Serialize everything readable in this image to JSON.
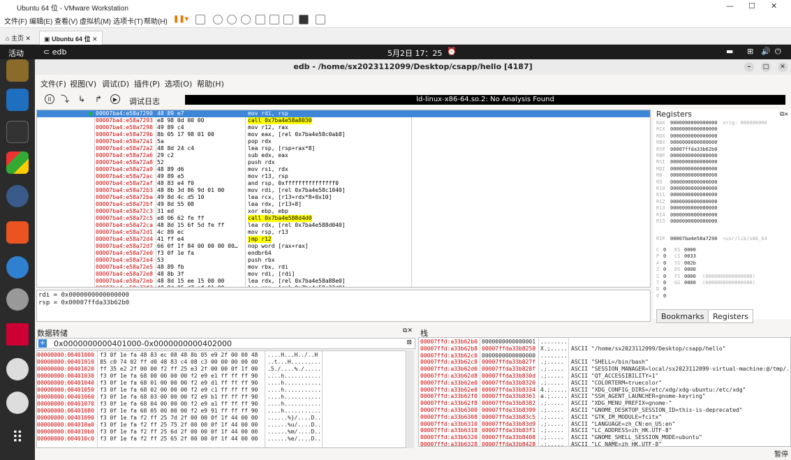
{
  "vmware": {
    "title": "Ubuntu 64 位 - VMware Workstation",
    "menu": [
      "文件(F)",
      "编辑(E)",
      "查看(V)",
      "虚拟机(M)",
      "选项卡(T)",
      "帮助(H)"
    ],
    "tabs": [
      "主页",
      "Ubuntu 64 位"
    ]
  },
  "gnome": {
    "activities": "活动",
    "app": "edb",
    "clock": "5月2日 17：25"
  },
  "edb": {
    "title": "edb - /home/sx2023112099/Desktop/csapp/hello [4187]",
    "menu": [
      "文件(F)",
      "视图(V)",
      "调试(D)",
      "插件(P)",
      "选项(O)",
      "帮助(H)"
    ],
    "log_button": "调试日志",
    "status": "ld-linux-x86-64.so.2: No Analysis Found",
    "disasm": [
      {
        "addr": "00007ba4:e58a7290",
        "bytes": "48 89 e7",
        "ins": "mov rdi, rsp",
        "sel": true
      },
      {
        "addr": "00007ba4:e58a7293",
        "bytes": "e8 98 0d 00 00",
        "ins": "call 0x7ba4e58a8030",
        "hl": "call"
      },
      {
        "addr": "00007ba4:e58a7298",
        "bytes": "49 89 c4",
        "ins": "mov r12, rax"
      },
      {
        "addr": "00007ba4:e58a729b",
        "bytes": "8b 05 17 98 01 00",
        "ins": "mov eax, [rel 0x7ba4e58c0ab8]"
      },
      {
        "addr": "00007ba4:e58a72a1",
        "bytes": "5a",
        "ins": "pop rdx"
      },
      {
        "addr": "00007ba4:e58a72a2",
        "bytes": "48 8d 24 c4",
        "ins": "lea rsp, [rsp+rax*8]"
      },
      {
        "addr": "00007ba4:e58a72a6",
        "bytes": "29 c2",
        "ins": "sub edx, eax"
      },
      {
        "addr": "00007ba4:e58a72a8",
        "bytes": "52",
        "ins": "push rdx"
      },
      {
        "addr": "00007ba4:e58a72a9",
        "bytes": "48 89 d6",
        "ins": "mov rsi, rdx"
      },
      {
        "addr": "00007ba4:e58a72ac",
        "bytes": "49 89 e5",
        "ins": "mov r13, rsp"
      },
      {
        "addr": "00007ba4:e58a72af",
        "bytes": "48 83 e4 f0",
        "ins": "and rsp, 0xfffffffffffffff0"
      },
      {
        "addr": "00007ba4:e58a72b3",
        "bytes": "48 8b 3d 86 9d 01 00",
        "ins": "mov rdi, [rel 0x7ba4e58c1040]"
      },
      {
        "addr": "00007ba4:e58a72ba",
        "bytes": "49 8d 4c d5 10",
        "ins": "lea rcx, [r13+rdx*8+0x10]"
      },
      {
        "addr": "00007ba4:e58a72bf",
        "bytes": "49 8d 55 08",
        "ins": "lea rdx, [r13+8]"
      },
      {
        "addr": "00007ba4:e58a72c3",
        "bytes": "31 ed",
        "ins": "xor ebp, ebp"
      },
      {
        "addr": "00007ba4:e58a72c5",
        "bytes": "e8 06 62 fe ff",
        "ins": "call 0x7ba4e588d4d0",
        "hl": "call"
      },
      {
        "addr": "00007ba4:e58a72ca",
        "bytes": "48 8d 15 6f 5d fe ff",
        "ins": "lea rdx, [rel 0x7ba4e588d040]"
      },
      {
        "addr": "00007ba4:e58a72d1",
        "bytes": "4c 89 ec",
        "ins": "mov rsp, r13"
      },
      {
        "addr": "00007ba4:e58a72d4",
        "bytes": "41 ff e4",
        "ins": "jmp r12",
        "hl": "jmp"
      },
      {
        "addr": "00007ba4:e58a72d7",
        "bytes": "66 0f 1f 84 00 00 00 00…",
        "ins": "nop word [rax+rax]",
        "dim": true
      },
      {
        "addr": "00007ba4:e58a72e0",
        "bytes": "f3 0f 1e fa",
        "ins": "endbr64"
      },
      {
        "addr": "00007ba4:e58a72e4",
        "bytes": "53",
        "ins": "push rbx"
      },
      {
        "addr": "00007ba4:e58a72e5",
        "bytes": "48 89 fb",
        "ins": "mov rbx, rdi"
      },
      {
        "addr": "00007ba4:e58a72e8",
        "bytes": "48 8b 3f",
        "ins": "mov rdi, [rdi]"
      },
      {
        "addr": "00007ba4:e58a72eb",
        "bytes": "48 8d 15 ee 15 00 00",
        "ins": "lea rdx, [rel 0x7ba4e58a88e0]"
      },
      {
        "addr": "00007ba4:e58a72f2",
        "bytes": "48 8d 05 d7 af 01 00",
        "ins": "lea rax, [rel 0x7ba4e58c22d0]"
      }
    ],
    "expr": [
      "rdi = 0x0000000000000000",
      "rsp = 0x00007ffda33b62b0"
    ],
    "registers": {
      "header": "Registers",
      "gp": [
        [
          "RAX",
          "0000000000000000",
          "orig: 000000000"
        ],
        [
          "RCX",
          "0000000000000000",
          ""
        ],
        [
          "RDX",
          "0000000000000000",
          ""
        ],
        [
          "RBX",
          "0000000000000000",
          ""
        ],
        [
          "RSP",
          "00007ffda33b62b0",
          ""
        ],
        [
          "RBP",
          "0000000000000000",
          ""
        ],
        [
          "RSI",
          "0000000000000000",
          ""
        ],
        [
          "RDI",
          "0000000000000000",
          ""
        ],
        [
          "R8",
          "0000000000000000",
          ""
        ],
        [
          "R9",
          "0000000000000000",
          ""
        ],
        [
          "R10",
          "0000000000000000",
          ""
        ],
        [
          "R11",
          "0000000000000000",
          ""
        ],
        [
          "R12",
          "0000000000000000",
          ""
        ],
        [
          "R13",
          "0000000000000000",
          ""
        ],
        [
          "R14",
          "0000000000000000",
          ""
        ],
        [
          "R15",
          "0000000000000000",
          ""
        ]
      ],
      "rip": [
        "RIP",
        "00007ba4e58a7290",
        "<usr/lib/x86_64"
      ],
      "flags": [
        [
          "C",
          "0",
          "ES",
          "0000",
          ""
        ],
        [
          "P",
          "0",
          "CS",
          "0033",
          ""
        ],
        [
          "A",
          "0",
          "SS",
          "002b",
          ""
        ],
        [
          "Z",
          "0",
          "DS",
          "0000",
          ""
        ],
        [
          "S",
          "0",
          "FS",
          "0000",
          "(0000000000000000)"
        ],
        [
          "T",
          "0",
          "GS",
          "0000",
          "(0000000000000000)"
        ],
        [
          "D",
          "0",
          "",
          "",
          ""
        ],
        [
          "O",
          "0",
          "",
          "",
          ""
        ]
      ]
    },
    "reg_tabs": [
      "Bookmarks",
      "Registers"
    ],
    "dump": {
      "header": "数据转储",
      "range": "0x0000000000401000-0x0000000000402000",
      "rows": [
        [
          "00000000:00401000",
          "f3 0f 1e fa 48 83 ec 08 48 8b 05 e9 2f 00 00 48",
          "....H...H../..H"
        ],
        [
          "00000000:00401010",
          "85 c0 74 02 ff d0 48 83 c4 08 c3 00 00 00 00 00",
          "..t...H........."
        ],
        [
          "00000000:00401020",
          "ff 35 e2 2f 00 00 f2 ff 25 e3 2f 00 00 0f 1f 00",
          ".5./....%./....."
        ],
        [
          "00000000:00401030",
          "f3 0f 1e fa 68 00 00 00 00 f2 e9 e1 ff ff ff 90",
          "....h..........."
        ],
        [
          "00000000:00401040",
          "f3 0f 1e fa 68 01 00 00 00 f2 e9 d1 ff ff ff 90",
          "....h..........."
        ],
        [
          "00000000:00401050",
          "f3 0f 1e fa 68 02 00 00 00 f2 e9 c1 ff ff ff 90",
          "....h..........."
        ],
        [
          "00000000:00401060",
          "f3 0f 1e fa 68 03 00 00 00 f2 e9 b1 ff ff ff 90",
          "....h..........."
        ],
        [
          "00000000:00401070",
          "f3 0f 1e fa 68 04 00 00 00 f2 e9 a1 ff ff ff 90",
          "....h..........."
        ],
        [
          "00000000:00401080",
          "f3 0f 1e fa 68 05 00 00 00 f2 e9 91 ff ff ff 90",
          "....h..........."
        ],
        [
          "00000000:00401090",
          "f3 0f 1e fa f2 ff 25 7d 2f 00 00 0f 1f 44 00 00",
          "......%}/....D.."
        ],
        [
          "00000000:004010a0",
          "f3 0f 1e fa f2 ff 25 75 2f 00 00 0f 1f 44 00 00",
          "......%u/....D.."
        ],
        [
          "00000000:004010b0",
          "f3 0f 1e fa f2 ff 25 6d 2f 00 00 0f 1f 44 00 00",
          "......%m/....D.."
        ],
        [
          "00000000:004010c0",
          "f3 0f 1e fa f2 ff 25 65 2f 00 00 0f 1f 44 00 00",
          "......%e/....D.."
        ]
      ]
    },
    "stack": {
      "header": "栈",
      "rows": [
        [
          "00007ffd:a33b62b0",
          "0000000000000001",
          "........",
          ""
        ],
        [
          "00007ffd:a33b62b8",
          "00007ffda33b8258",
          "X.;.....",
          "ASCII \"/home/sx2023112099/Desktop/csapp/hello\""
        ],
        [
          "00007ffd:a33b62c0",
          "0000000000000000",
          "........",
          ""
        ],
        [
          "00007ffd:a33b62c8",
          "00007ffda33b827f",
          ".;.....",
          "ASCII \"SHELL=/bin/bash\""
        ],
        [
          "00007ffd:a33b62d0",
          "00007ffda33b828f",
          ".;.....",
          "ASCII \"SESSION_MANAGER=local/sx2023112099-virtual-machine:@/tmp/.\""
        ],
        [
          "00007ffd:a33b62d8",
          "00007ffda33b830d",
          ".;.....",
          "ASCII \"QT_ACCESSIBILITY=1\""
        ],
        [
          "00007ffd:a33b62e0",
          "00007ffda33b8320",
          ".;.....",
          "ASCII \"COLORTERM=truecolor\""
        ],
        [
          "00007ffd:a33b62e8",
          "00007ffda33b8334",
          "4.;.....",
          "ASCII \"XDG_CONFIG_DIRS=/etc/xdg/xdg-ubuntu:/etc/xdg\""
        ],
        [
          "00007ffd:a33b62f0",
          "00007ffda33b8361",
          "a.;.....",
          "ASCII \"SSH_AGENT_LAUNCHER=gnome-keyring\""
        ],
        [
          "00007ffd:a33b62f8",
          "00007ffda33b8382",
          ".;.....",
          "ASCII \"XDG_MENU_PREFIX=gnome-\""
        ],
        [
          "00007ffd:a33b6300",
          "00007ffda33b8399",
          ".;.....",
          "ASCII \"GNOME_DESKTOP_SESSION_ID=this-is-deprecated\""
        ],
        [
          "00007ffd:a33b6308",
          "00007ffda33b83c5",
          ".;.....",
          "ASCII \"GTK_IM_MODULE=fcitx\""
        ],
        [
          "00007ffd:a33b6310",
          "00007ffda33b83d9",
          ".;.....",
          "ASCII \"LANGUAGE=zh_CN:en_US:en\""
        ],
        [
          "00007ffd:a33b6318",
          "00007ffda33b83f1",
          ".;.....",
          "ASCII \"LC_ADDRESS=zh_HK.UTF-8\""
        ],
        [
          "00007ffd:a33b6320",
          "00007ffda33b8408",
          ".;.....",
          "ASCII \"GNOME_SHELL_SESSION_MODE=ubuntu\""
        ],
        [
          "00007ffd:a33b6328",
          "00007ffda33b8428",
          ".;.....",
          "ASCII \"LC_NAME=zh_HK.UTF-8\""
        ]
      ]
    },
    "pause": "暂停"
  }
}
